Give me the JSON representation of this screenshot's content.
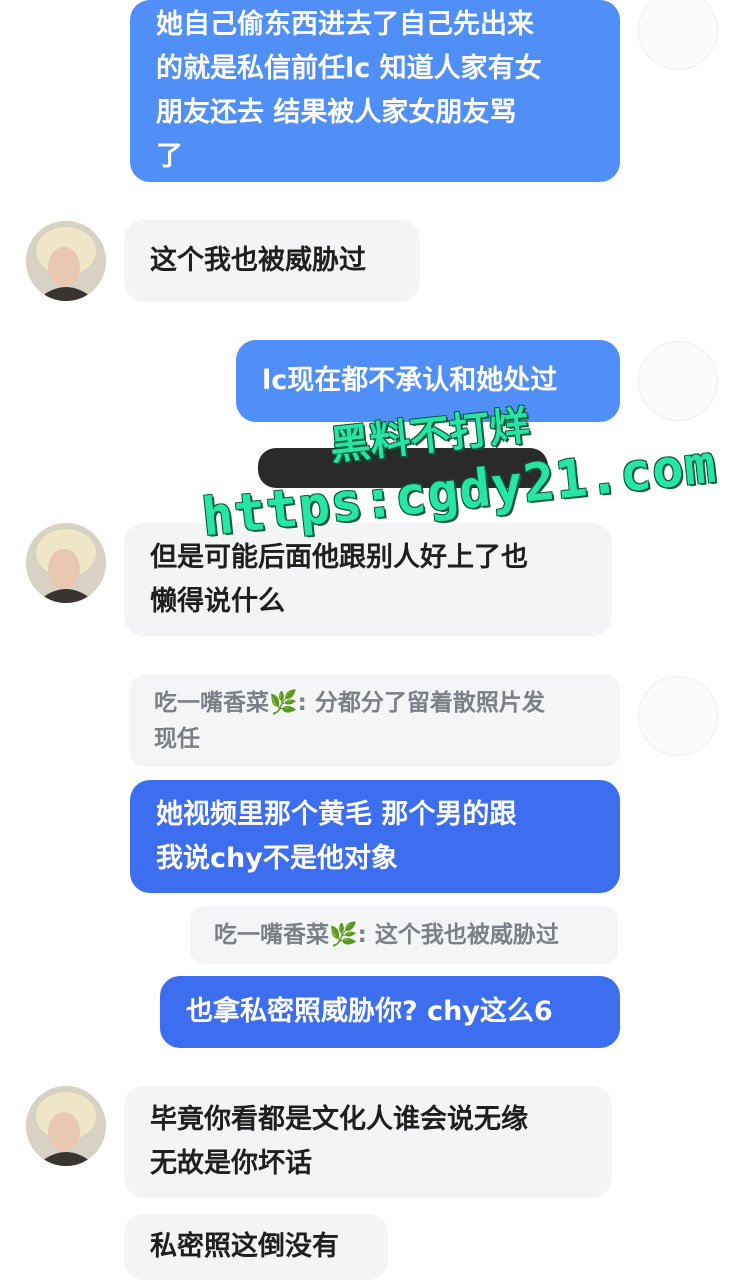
{
  "colors": {
    "outgoing_bubble": "#4f8ff7",
    "outgoing_bubble_dark": "#3e6ef0",
    "incoming_bubble": "#f3f4f6",
    "watermark": "#27e6a3"
  },
  "messages": [
    {
      "id": "m1",
      "side": "outgoing",
      "text": "她自己偷东西进去了自己先出来\n的就是私信前任lc 知道人家有女\n朋友还去 结果被人家女朋友骂\n了"
    },
    {
      "id": "m2",
      "side": "incoming",
      "text": "这个我也被威胁过"
    },
    {
      "id": "m3",
      "side": "outgoing",
      "text": "lc现在都不承认和她处过"
    },
    {
      "id": "m4",
      "side": "incoming",
      "text": "但是可能后面他跟别人好上了也\n懒得说什么"
    },
    {
      "id": "q1",
      "side": "quote",
      "text": "吃一嘴香菜🌿: 分都分了留着散照片发\n现任"
    },
    {
      "id": "m5",
      "side": "outgoing",
      "text": "她视频里那个黄毛 那个男的跟\n我说chy不是他对象"
    },
    {
      "id": "q2",
      "side": "quote",
      "text": "吃一嘴香菜🌿: 这个我也被威胁过"
    },
    {
      "id": "m6",
      "side": "outgoing",
      "text": "也拿私密照威胁你? chy这么6"
    },
    {
      "id": "m7",
      "side": "incoming",
      "text": "毕竟你看都是文化人谁会说无缘\n无故是你坏话"
    },
    {
      "id": "m8",
      "side": "incoming",
      "text": "私密照这倒没有"
    }
  ],
  "watermark": {
    "line1": "黑料不打烊",
    "line2": "https:cgdy21.com"
  }
}
